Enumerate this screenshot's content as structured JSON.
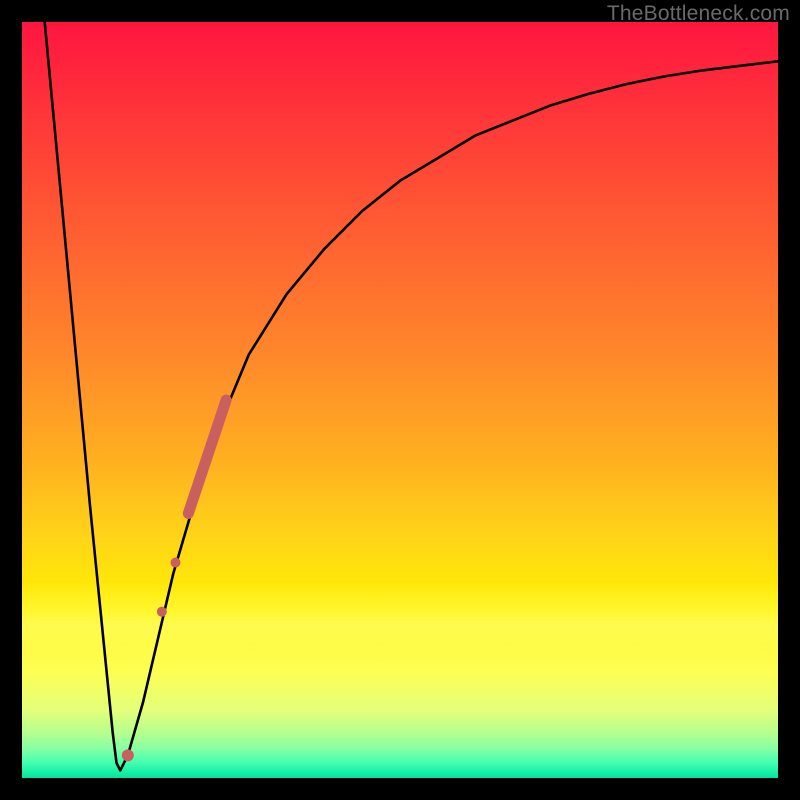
{
  "watermark": "TheBottleneck.com",
  "chart_data": {
    "type": "line",
    "title": "",
    "xlabel": "",
    "ylabel": "",
    "xlim": [
      0,
      100
    ],
    "ylim": [
      0,
      100
    ],
    "grid": false,
    "series": [
      {
        "name": "curve",
        "x": [
          3,
          6,
          9,
          12,
          12.5,
          13,
          14,
          16,
          20,
          25,
          30,
          35,
          40,
          45,
          50,
          55,
          60,
          65,
          70,
          75,
          80,
          85,
          90,
          95,
          100
        ],
        "y": [
          100,
          68,
          36,
          6,
          2,
          1,
          3,
          10,
          27,
          44,
          56,
          64,
          70,
          75,
          79,
          82,
          85,
          87,
          89,
          90.5,
          91.8,
          92.8,
          93.6,
          94.2,
          94.8
        ]
      }
    ],
    "markers": [
      {
        "name": "thick-segment",
        "type": "thick-line",
        "x1": 22,
        "y1": 35,
        "x2": 27,
        "y2": 50,
        "color": "#ca5f5f",
        "width": 11
      },
      {
        "name": "dot-mid",
        "type": "circle",
        "x": 20.3,
        "y": 28.5,
        "r": 5,
        "color": "#ca5f5f"
      },
      {
        "name": "dot-low",
        "type": "circle",
        "x": 18.5,
        "y": 22,
        "r": 5,
        "color": "#ca5f5f"
      },
      {
        "name": "dot-bottom",
        "type": "circle",
        "x": 14,
        "y": 3,
        "r": 6,
        "color": "#ca5f5f"
      }
    ],
    "background": {
      "type": "vertical-gradient",
      "stops": [
        {
          "pos": 0.0,
          "color": "#ff1540"
        },
        {
          "pos": 0.5,
          "color": "#ffb020"
        },
        {
          "pos": 0.8,
          "color": "#fff200"
        },
        {
          "pos": 1.0,
          "color": "#00e6a0"
        }
      ]
    }
  }
}
